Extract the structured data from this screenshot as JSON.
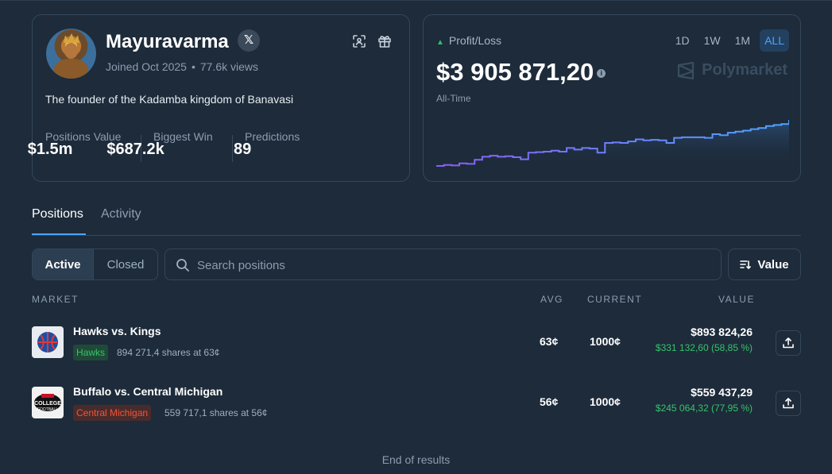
{
  "profile": {
    "username": "Mayuravarma",
    "x_label": "𝕏",
    "joined": "Joined Oct 2025",
    "views": "77.6k views",
    "bio": "The founder of the Kadamba kingdom of Banavasi",
    "stats": [
      {
        "label": "Positions Value",
        "value": "$1.5m"
      },
      {
        "label": "Biggest Win",
        "value": "$687.2k"
      },
      {
        "label": "Predictions",
        "value": "89"
      }
    ]
  },
  "pnl": {
    "label": "Profit/Loss",
    "value": "$3 905 871,20",
    "period_label": "All-Time",
    "ranges": [
      "1D",
      "1W",
      "1M",
      "ALL"
    ],
    "active_range": "ALL",
    "brand": "Polymarket",
    "accent": "#4da3ff",
    "line_start_color": "#8e5cf7",
    "line_end_color": "#4da3ff"
  },
  "chart_data": {
    "type": "line",
    "title": "",
    "xlabel": "",
    "ylabel": "",
    "grid": false,
    "values": [
      0.1,
      0.12,
      0.11,
      0.15,
      0.14,
      0.22,
      0.28,
      0.3,
      0.28,
      0.29,
      0.27,
      0.23,
      0.36,
      0.37,
      0.38,
      0.4,
      0.38,
      0.45,
      0.42,
      0.45,
      0.44,
      0.36,
      0.55,
      0.56,
      0.55,
      0.58,
      0.62,
      0.6,
      0.61,
      0.6,
      0.55,
      0.65,
      0.66,
      0.66,
      0.66,
      0.65,
      0.72,
      0.7,
      0.75,
      0.77,
      0.79,
      0.82,
      0.84,
      0.88,
      0.9,
      0.92,
      1.0
    ]
  },
  "tabs": [
    {
      "label": "Positions",
      "active": true
    },
    {
      "label": "Activity",
      "active": false
    }
  ],
  "filters": {
    "active": "Active",
    "closed": "Closed",
    "search_placeholder": "Search positions",
    "sort_label": "Value"
  },
  "table": {
    "headers": {
      "market": "MARKET",
      "avg": "AVG",
      "current": "CURRENT",
      "value": "VALUE"
    },
    "rows": [
      {
        "title": "Hawks vs. Kings",
        "outcome": "Hawks",
        "outcome_color": "green",
        "shares": "894 271,4 shares at 63¢",
        "avg": "63¢",
        "current": "1000¢",
        "value": "$893 824,26",
        "pnl": "$331 132,60 (58,85 %)"
      },
      {
        "title": "Buffalo vs. Central Michigan",
        "outcome": "Central Michigan",
        "outcome_color": "red",
        "shares": "559 717,1 shares at 56¢",
        "avg": "56¢",
        "current": "1000¢",
        "value": "$559 437,29",
        "pnl": "$245 064,32 (77,95 %)"
      }
    ]
  },
  "footer": {
    "end_text": "End of results"
  }
}
